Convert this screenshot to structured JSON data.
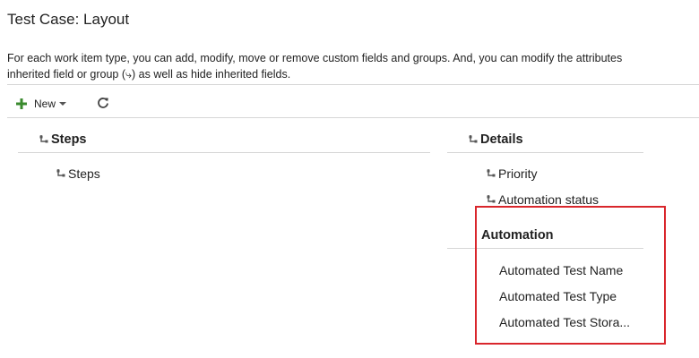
{
  "page": {
    "title": "Test Case: Layout",
    "description_line1": "For each work item type, you can add, modify, move or remove custom fields and groups. And, you can modify the attributes",
    "description_line2": "inherited field or group (⤷) as well as hide inherited fields."
  },
  "toolbar": {
    "new_label": "New",
    "new_icon": "plus-icon",
    "new_icon_color": "#3a8a2e",
    "refresh_icon": "refresh-icon"
  },
  "layout": {
    "left_column": {
      "groups": [
        {
          "header": "Steps",
          "inherited": true,
          "fields": [
            {
              "label": "Steps",
              "inherited": true
            }
          ]
        }
      ]
    },
    "right_column": {
      "groups": [
        {
          "header": "Details",
          "inherited": true,
          "fields": [
            {
              "label": "Priority",
              "inherited": true
            },
            {
              "label": "Automation status",
              "inherited": true
            }
          ]
        },
        {
          "header": "Automation",
          "inherited": false,
          "fields": [
            {
              "label": "Automated Test Name",
              "inherited": false
            },
            {
              "label": "Automated Test Type",
              "inherited": false
            },
            {
              "label": "Automated Test Stora...",
              "inherited": false
            }
          ]
        }
      ]
    }
  },
  "highlight_color": "#d9262c"
}
